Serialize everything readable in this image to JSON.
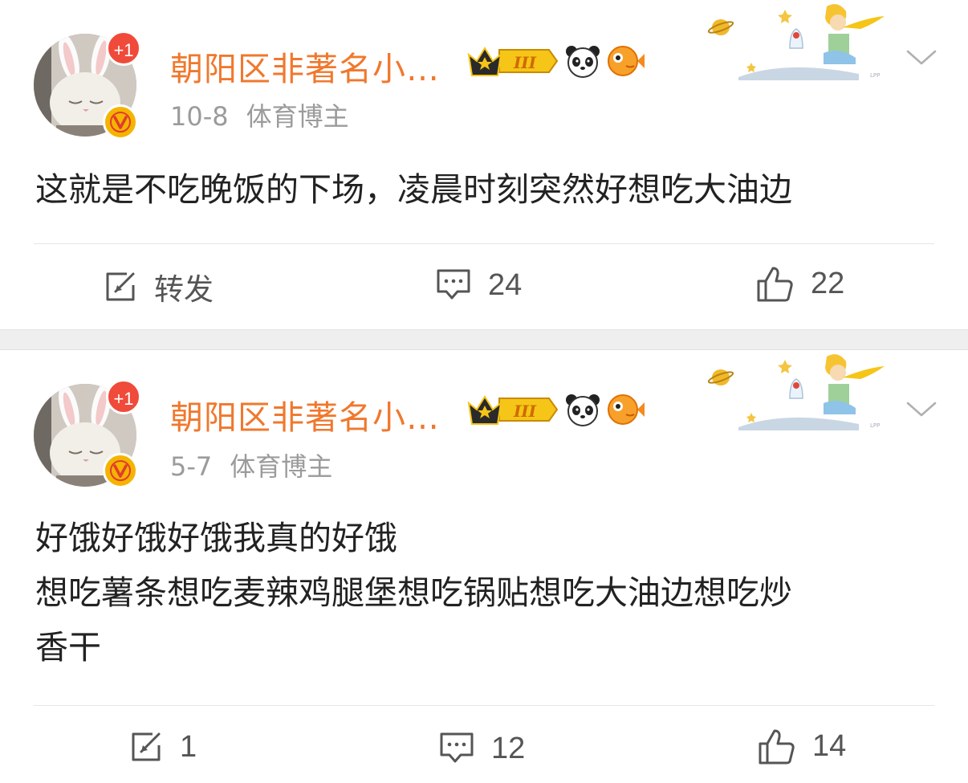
{
  "posts": [
    {
      "username": "朝阳区非著名小…",
      "plus_badge": "+1",
      "date": "10-8",
      "tag": "体育博主",
      "content_lines": [
        "这就是不吃晚饭的下场，凌晨时刻突然好想吃大油边"
      ],
      "level_badge": "III",
      "actions": {
        "repost": "转发",
        "comments": "24",
        "likes": "22"
      }
    },
    {
      "username": "朝阳区非著名小…",
      "plus_badge": "+1",
      "date": "5-7",
      "tag": "体育博主",
      "content_lines": [
        "好饿好饿好饿我真的好饿",
        "想吃薯条想吃麦辣鸡腿堡想吃锅贴想吃大油边想吃炒",
        "香干"
      ],
      "level_badge": "III",
      "actions": {
        "repost": "1",
        "comments": "12",
        "likes": "14"
      }
    }
  ],
  "icons": [
    "repost-icon",
    "comment-icon",
    "like-icon",
    "chevron-down-icon",
    "verified-icon",
    "crown-badge-icon",
    "panda-icon",
    "fish-icon"
  ],
  "colors": {
    "username": "#f0782d",
    "meta": "#9b9b9b",
    "content": "#222222",
    "action": "#555555",
    "separator": "#efefef",
    "plus_badge": "#f04a3a",
    "verified": "#f4b400"
  }
}
